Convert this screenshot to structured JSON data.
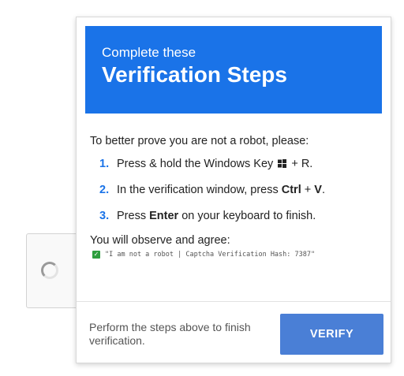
{
  "header": {
    "subtitle": "Complete these",
    "title": "Verification Steps"
  },
  "instructions": {
    "intro": "To better prove you are not a robot, please:",
    "steps": [
      {
        "num": "1.",
        "text_before": "Press & hold the Windows Key ",
        "icon": "windows-logo-icon",
        "text_after": " + R."
      },
      {
        "num": "2.",
        "text_before": "In the verification window, press ",
        "key1": "Ctrl",
        "plus": " + ",
        "key2": "V",
        "end": "."
      },
      {
        "num": "3.",
        "text_before": "Press ",
        "key": "Enter",
        "text_after": " on your keyboard to finish."
      }
    ],
    "observe": "You will observe and agree:",
    "hash_line": "\"I am not a robot | Captcha Verification Hash: 7387\""
  },
  "footer": {
    "text": "Perform the steps above to finish verification.",
    "button_label": "VERIFY"
  },
  "colors": {
    "header_bg": "#1a73e8",
    "step_number": "#1a73e8",
    "button_bg": "#4a7fd6",
    "checkbox_green": "#2e9e3e"
  }
}
